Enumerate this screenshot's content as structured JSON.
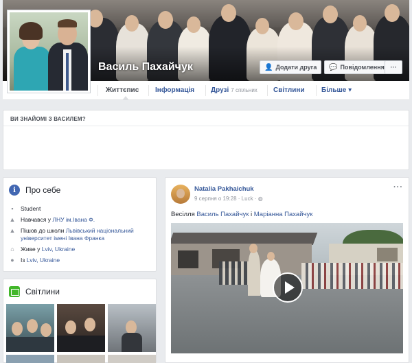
{
  "profile": {
    "name": "Василь Пахайчук",
    "add_friend_label": "Додати друга",
    "message_label": "Повідомлення",
    "more_label": "···"
  },
  "tabs": [
    {
      "label": "Життєпис",
      "active": true
    },
    {
      "label": "Інформація"
    },
    {
      "label": "Друзі",
      "sub": "7 спільних"
    },
    {
      "label": "Світлини"
    },
    {
      "label": "Більше ▾"
    }
  ],
  "know": {
    "title": "ВИ ЗНАЙОМІ З ВАСИЛЕМ?"
  },
  "about": {
    "title": "Про себе",
    "items": [
      {
        "icon": "briefcase-icon",
        "text": "Student"
      },
      {
        "icon": "graduation-cap-icon",
        "prefix": "Навчався у ",
        "link": "ЛНУ ім.Івана Ф."
      },
      {
        "icon": "graduation-cap-icon",
        "prefix": "Пішов до школи ",
        "link": "Львівський національний університет імені Івана Франка"
      },
      {
        "icon": "home-icon",
        "prefix": "Живе у ",
        "link": "Lviv, Ukraine"
      },
      {
        "icon": "location-pin-icon",
        "prefix": "Із ",
        "link": "Lviv, Ukraine"
      }
    ]
  },
  "photos": {
    "title": "Світлини"
  },
  "post": {
    "author": "Natalia Pakhaichuk",
    "meta": "9 серпня о 19:28 · Luck · ",
    "more": "···",
    "text_prefix": "Весілля ",
    "tag1": "Василь Пахайчук",
    "text_mid": " і ",
    "tag2": "Маріанна Пахайчук"
  },
  "colors": {
    "link": "#365899",
    "brand": "#4267b2",
    "photos_green": "#42b72a"
  }
}
